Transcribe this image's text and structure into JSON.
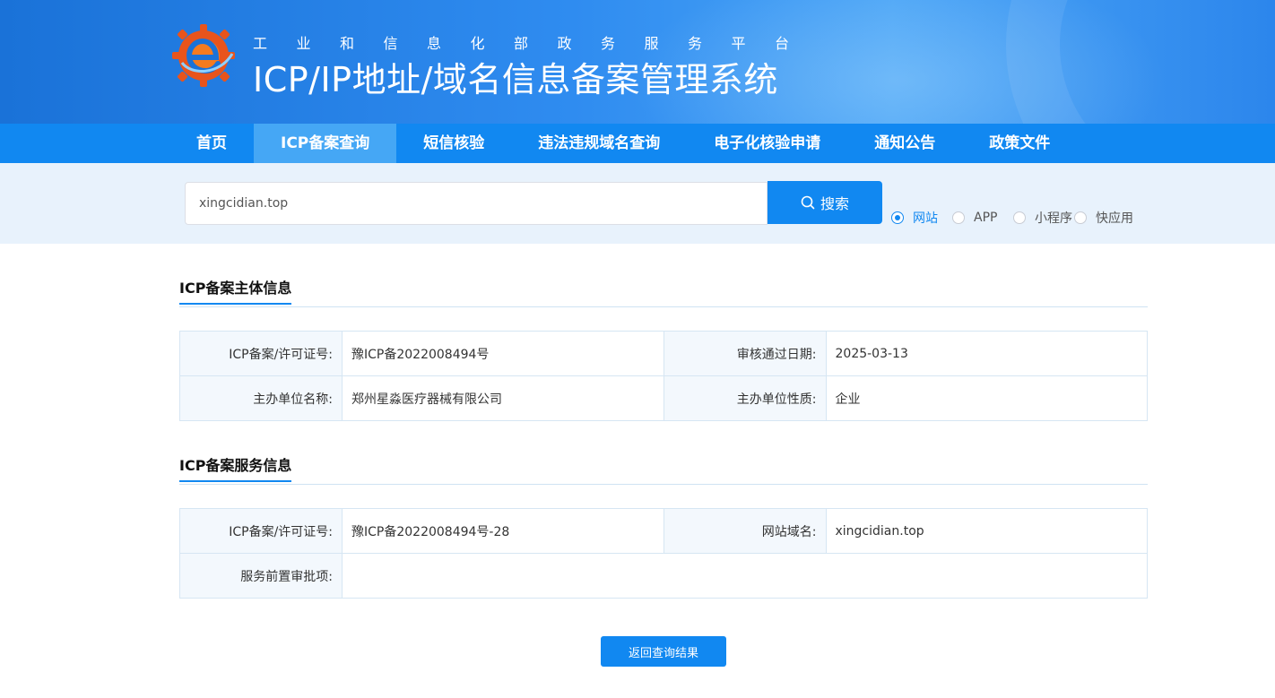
{
  "header": {
    "subtitle": "工业和信息化部政务服务平台",
    "title": "ICP/IP地址/域名信息备案管理系统"
  },
  "nav": {
    "items": [
      {
        "label": "首页"
      },
      {
        "label": "ICP备案查询"
      },
      {
        "label": "短信核验"
      },
      {
        "label": "违法违规域名查询"
      },
      {
        "label": "电子化核验申请"
      },
      {
        "label": "通知公告"
      },
      {
        "label": "政策文件"
      }
    ],
    "active": "ICP备案查询"
  },
  "search": {
    "value": "xingcidian.top",
    "button_label": "搜索",
    "options": [
      {
        "label": "网站",
        "checked": true
      },
      {
        "label": "APP",
        "checked": false
      },
      {
        "label": "小程序",
        "checked": false
      },
      {
        "label": "快应用",
        "checked": false
      }
    ]
  },
  "subject_info": {
    "title": "ICP备案主体信息",
    "rows": [
      {
        "label1": "ICP备案/许可证号:",
        "value1": "豫ICP备2022008494号",
        "label2": "审核通过日期:",
        "value2": "2025-03-13"
      },
      {
        "label1": "主办单位名称:",
        "value1": "郑州星淼医疗器械有限公司",
        "label2": "主办单位性质:",
        "value2": "企业"
      }
    ]
  },
  "service_info": {
    "title": "ICP备案服务信息",
    "rows": [
      {
        "label1": "ICP备案/许可证号:",
        "value1": "豫ICP备2022008494号-28",
        "label2": "网站域名:",
        "value2": "xingcidian.top"
      },
      {
        "label1": "服务前置审批项:",
        "value1": ""
      }
    ]
  },
  "back_button_label": "返回查询结果",
  "colors": {
    "primary": "#1188f1",
    "nav_active": "#45a7f5",
    "search_band": "#e8f2fc",
    "label_bg": "#f3f8fd"
  }
}
